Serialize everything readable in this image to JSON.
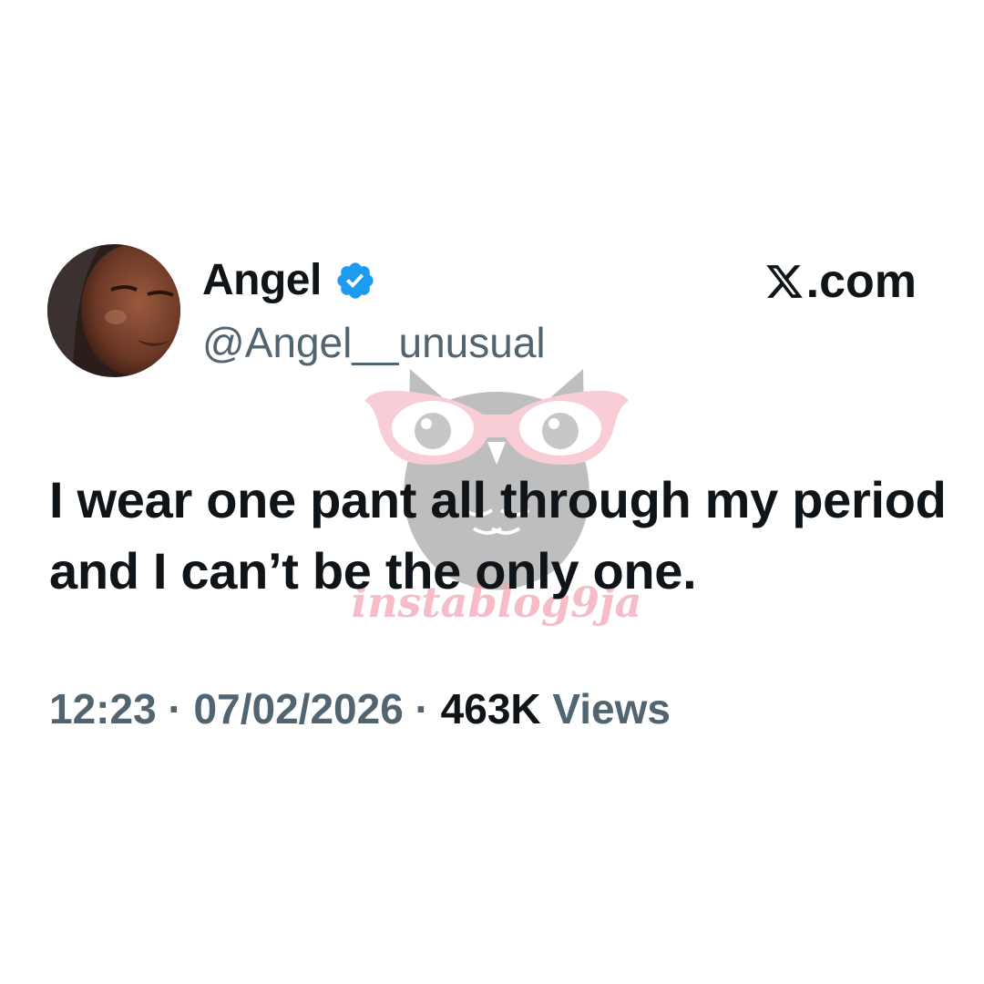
{
  "tweet": {
    "display_name": "Angel",
    "handle": "@Angel__unusual",
    "text": "I wear one pant all through my period and I can’t be the only one.",
    "time": "12:23",
    "date": "07/02/2026",
    "separator": " · ",
    "views_count": "463K",
    "views_label": " Views"
  },
  "brand": {
    "icon": "x-logo-icon",
    "text": ".com"
  },
  "watermark": {
    "text": "instablog9ja",
    "icon": "owl-glasses-logo"
  },
  "colors": {
    "text_primary": "#0f1419",
    "text_secondary": "#536471",
    "verified_blue": "#1d9bf0",
    "watermark_pink": "#f3a6b6",
    "watermark_gray": "#8a8a8a"
  }
}
